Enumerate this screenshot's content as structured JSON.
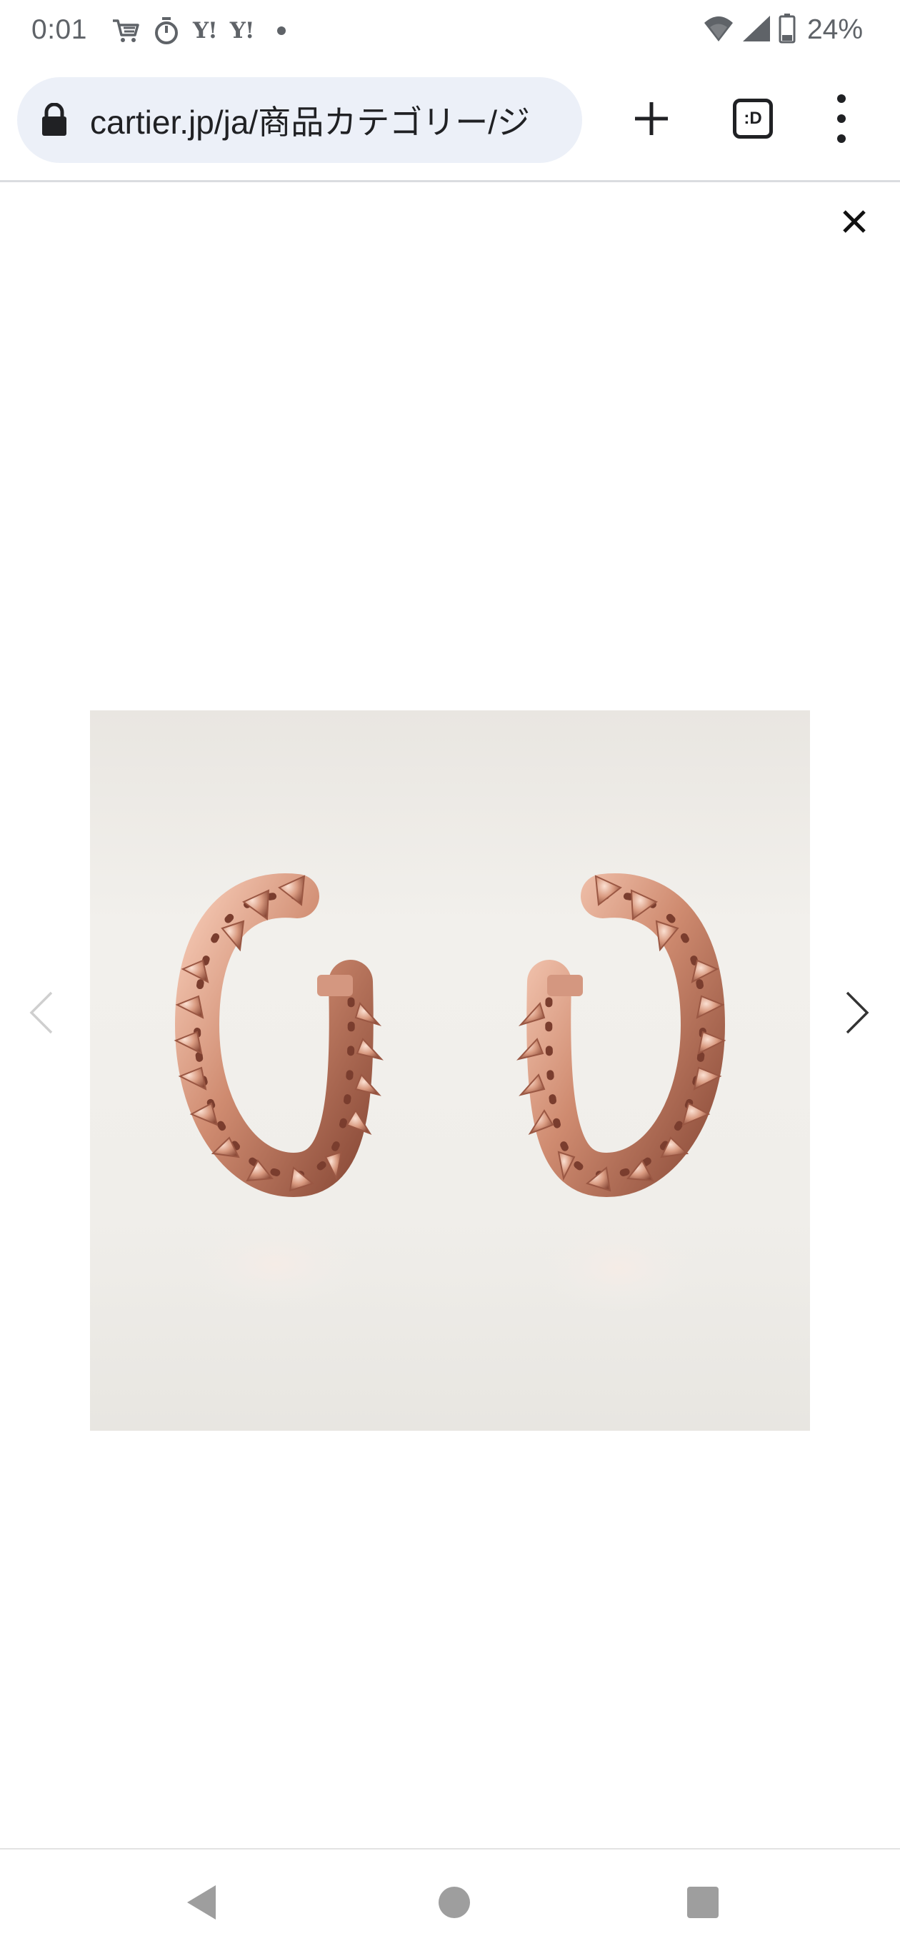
{
  "status_bar": {
    "time": "0:01",
    "notification_icons": [
      "shopping-cart-icon",
      "stopwatch-icon",
      "yahoo-icon",
      "yahoo-icon",
      "more-notifications-dot"
    ],
    "yahoo_label_1": "Y!",
    "yahoo_label_2": "Y!",
    "battery_percent": "24%",
    "signal_icons": [
      "wifi-icon",
      "cell-signal-icon",
      "battery-icon"
    ]
  },
  "browser": {
    "url": "cartier.jp/ja/商品カテゴリー/ジ",
    "tab_switcher_label": ":D",
    "toolbar_icons": [
      "lock-icon",
      "plus-icon",
      "tab-switcher-icon",
      "more-vert-icon"
    ]
  },
  "viewer": {
    "close_icon": "close-icon",
    "prev_icon": "chevron-left-icon",
    "next_icon": "chevron-right-icon",
    "prev_enabled": false,
    "next_enabled": true
  },
  "nav_bar": {
    "icons": [
      "back-icon",
      "home-icon",
      "recents-icon"
    ]
  },
  "colors": {
    "omnibox_bg": "#ecf0f8",
    "status_text": "#5f6368",
    "rose_gold": "#c8826a",
    "image_bg": "#eeece8"
  }
}
